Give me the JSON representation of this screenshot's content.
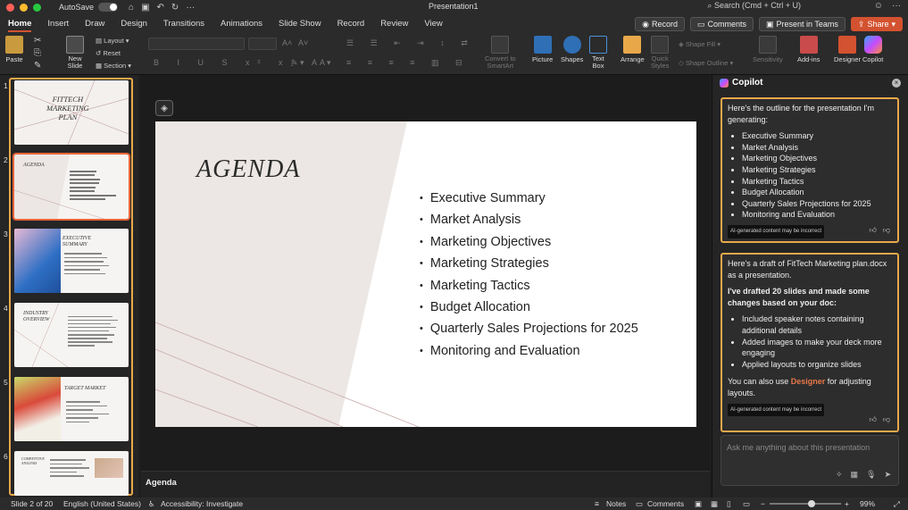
{
  "titlebar": {
    "autosave_label": "AutoSave",
    "doc_title": "Presentation1",
    "search_placeholder": "Search (Cmd + Ctrl + U)"
  },
  "tabs": [
    "Home",
    "Insert",
    "Draw",
    "Design",
    "Transitions",
    "Animations",
    "Slide Show",
    "Record",
    "Review",
    "View"
  ],
  "tab_buttons": {
    "record": "Record",
    "comments": "Comments",
    "present_teams": "Present in Teams",
    "share": "Share"
  },
  "ribbon": {
    "paste": "Paste",
    "new_slide": "New\nSlide",
    "layout": "Layout",
    "reset": "Reset",
    "section": "Section",
    "convert_smartart": "Convert to\nSmartArt",
    "picture": "Picture",
    "shapes": "Shapes",
    "text_box": "Text\nBox",
    "arrange": "Arrange",
    "quick_styles": "Quick\nStyles",
    "shape_fill": "Shape Fill",
    "shape_outline": "Shape Outline",
    "sensitivity": "Sensitivity",
    "addins": "Add-ins",
    "designer": "Designer",
    "copilot": "Copilot"
  },
  "thumbnails": [
    {
      "num": "1",
      "title": "FITTECH\nMARKETING\nPLAN"
    },
    {
      "num": "2",
      "title": "AGENDA"
    },
    {
      "num": "3",
      "title": "EXECUTIVE\nSUMMARY"
    },
    {
      "num": "4",
      "title": "INDUSTRY\nOVERVIEW"
    },
    {
      "num": "5",
      "title": "TARGET MARKET"
    },
    {
      "num": "6",
      "title": "COMPETITIVE\nANALYSIS"
    }
  ],
  "slide": {
    "title": "AGENDA",
    "items": [
      "Executive Summary",
      "Market Analysis",
      "Marketing Objectives",
      "Marketing Strategies",
      "Marketing Tactics",
      "Budget Allocation",
      "Quarterly Sales Projections for 2025",
      "Monitoring and Evaluation"
    ]
  },
  "notes": {
    "title": "Agenda"
  },
  "statusbar": {
    "slide_of": "Slide 2 of 20",
    "language": "English (United States)",
    "accessibility": "Accessibility: Investigate",
    "notes": "Notes",
    "comments": "Comments",
    "zoom": "99%"
  },
  "copilot": {
    "title": "Copilot",
    "card1": {
      "intro": "Here's the outline for the presentation I'm generating:",
      "items": [
        "Executive Summary",
        "Market Analysis",
        "Marketing Objectives",
        "Marketing Strategies",
        "Marketing Tactics",
        "Budget Allocation",
        "Quarterly Sales Projections for 2025",
        "Monitoring and Evaluation"
      ],
      "disclaimer": "AI-generated content may be incorrect"
    },
    "card2": {
      "intro": "Here's a draft of FitTech Marketing plan.docx as a presentation.",
      "bold": "I've drafted 20 slides and made some changes based on your doc:",
      "items": [
        "Included speaker notes containing additional details",
        "Added images to make your deck more engaging",
        "Applied layouts to organize slides"
      ],
      "also_prefix": "You can also use ",
      "also_link": "Designer",
      "also_suffix": " for adjusting layouts.",
      "disclaimer": "AI-generated content may be incorrect"
    },
    "input_placeholder": "Ask me anything about this presentation"
  },
  "colors": {
    "accent": "#d35230",
    "selection": "#e8a84a"
  }
}
